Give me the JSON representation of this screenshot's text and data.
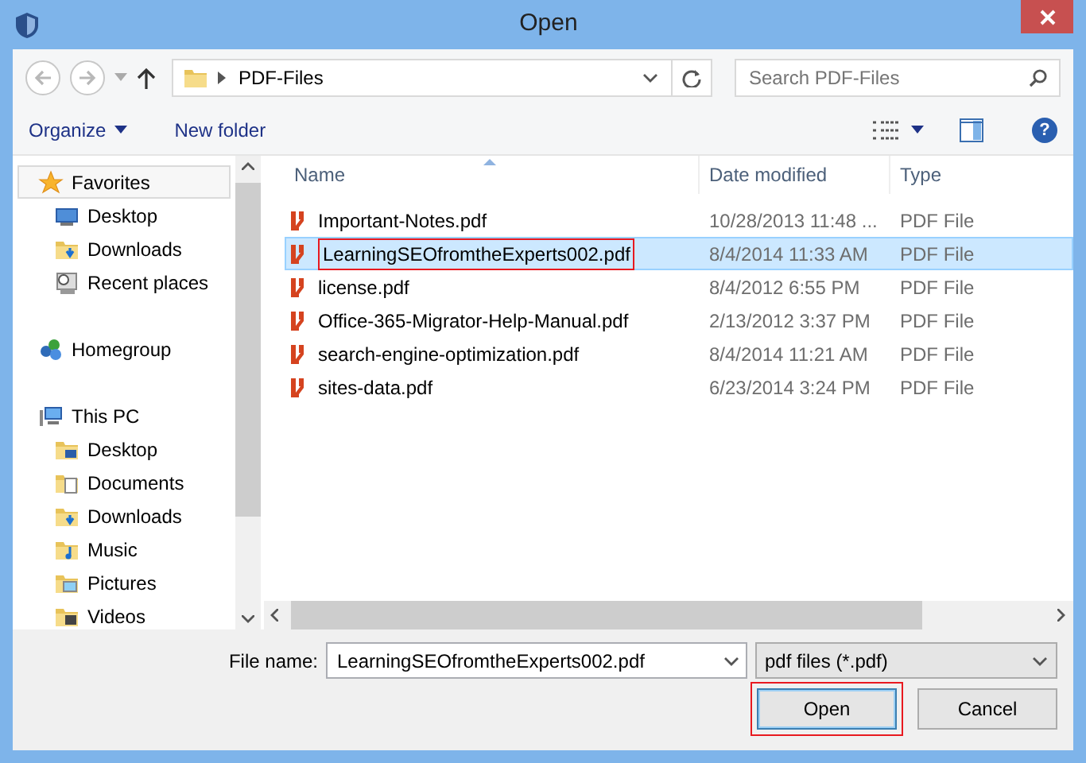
{
  "window": {
    "title": "Open"
  },
  "address_bar": {
    "path": "PDF-Files",
    "back_disabled": true,
    "forward_disabled": true
  },
  "search": {
    "placeholder": "Search PDF-Files"
  },
  "toolbar": {
    "organize": "Organize",
    "new_folder": "New folder",
    "help": "?"
  },
  "sidebar": {
    "items": [
      {
        "label": "Favorites",
        "kind": "favorites",
        "selected": true,
        "children": [
          {
            "label": "Desktop",
            "kind": "desktop",
            "selected": false
          },
          {
            "label": "Downloads",
            "kind": "downloads",
            "selected": false
          },
          {
            "label": "Recent places",
            "kind": "recent",
            "selected": false
          }
        ]
      },
      {
        "label": "Homegroup",
        "kind": "homegroup",
        "selected": false
      },
      {
        "label": "This PC",
        "kind": "pc",
        "selected": false,
        "children": [
          {
            "label": "Desktop",
            "kind": "desktop-folder",
            "selected": false
          },
          {
            "label": "Documents",
            "kind": "documents",
            "selected": false
          },
          {
            "label": "Downloads",
            "kind": "downloads",
            "selected": false
          },
          {
            "label": "Music",
            "kind": "music",
            "selected": false
          },
          {
            "label": "Pictures",
            "kind": "pictures",
            "selected": false
          },
          {
            "label": "Videos",
            "kind": "videos",
            "selected": false
          }
        ]
      }
    ]
  },
  "file_list": {
    "columns": [
      "Name",
      "Date modified",
      "Type"
    ],
    "rows": [
      {
        "name": "Important-Notes.pdf",
        "date": "10/28/2013 11:48 ...",
        "type": "PDF File",
        "selected": false,
        "highlighted": false
      },
      {
        "name": "LearningSEOfromtheExperts002.pdf",
        "date": "8/4/2014 11:33 AM",
        "type": "PDF File",
        "selected": true,
        "highlighted": true
      },
      {
        "name": "license.pdf",
        "date": "8/4/2012 6:55 PM",
        "type": "PDF File",
        "selected": false,
        "highlighted": false
      },
      {
        "name": "Office-365-Migrator-Help-Manual.pdf",
        "date": "2/13/2012 3:37 PM",
        "type": "PDF File",
        "selected": false,
        "highlighted": false
      },
      {
        "name": "search-engine-optimization.pdf",
        "date": "8/4/2014 11:21 AM",
        "type": "PDF File",
        "selected": false,
        "highlighted": false
      },
      {
        "name": "sites-data.pdf",
        "date": "6/23/2014 3:24 PM",
        "type": "PDF File",
        "selected": false,
        "highlighted": false
      }
    ]
  },
  "file_name": {
    "label": "File name:",
    "value": "LearningSEOfromtheExperts002.pdf"
  },
  "file_type": {
    "value": "pdf files (*.pdf)"
  },
  "buttons": [
    {
      "label": "Open",
      "kind": "default",
      "highlighted": true
    },
    {
      "label": "Cancel",
      "kind": "normal",
      "highlighted": false
    }
  ]
}
